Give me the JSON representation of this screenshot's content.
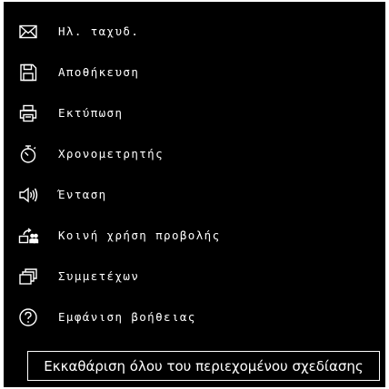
{
  "menu": {
    "items": [
      {
        "label": "Ηλ. ταχυδ.",
        "icon": "mail-icon"
      },
      {
        "label": "Αποθήκευση",
        "icon": "save-icon"
      },
      {
        "label": "Εκτύπωση",
        "icon": "print-icon"
      },
      {
        "label": "Χρονομετρητής",
        "icon": "timer-icon"
      },
      {
        "label": "Ένταση",
        "icon": "volume-icon"
      },
      {
        "label": "Κοινή χρήση προβολής",
        "icon": "share-screen-icon"
      },
      {
        "label": "Συμμετέχων",
        "icon": "participants-icon"
      },
      {
        "label": "Εμφάνιση βοήθειας",
        "icon": "help-icon"
      }
    ]
  },
  "clear_button": {
    "label": "Εκκαθάριση όλου του περιεχομένου σχεδίασης"
  },
  "colors": {
    "background": "#000000",
    "foreground": "#ffffff"
  }
}
